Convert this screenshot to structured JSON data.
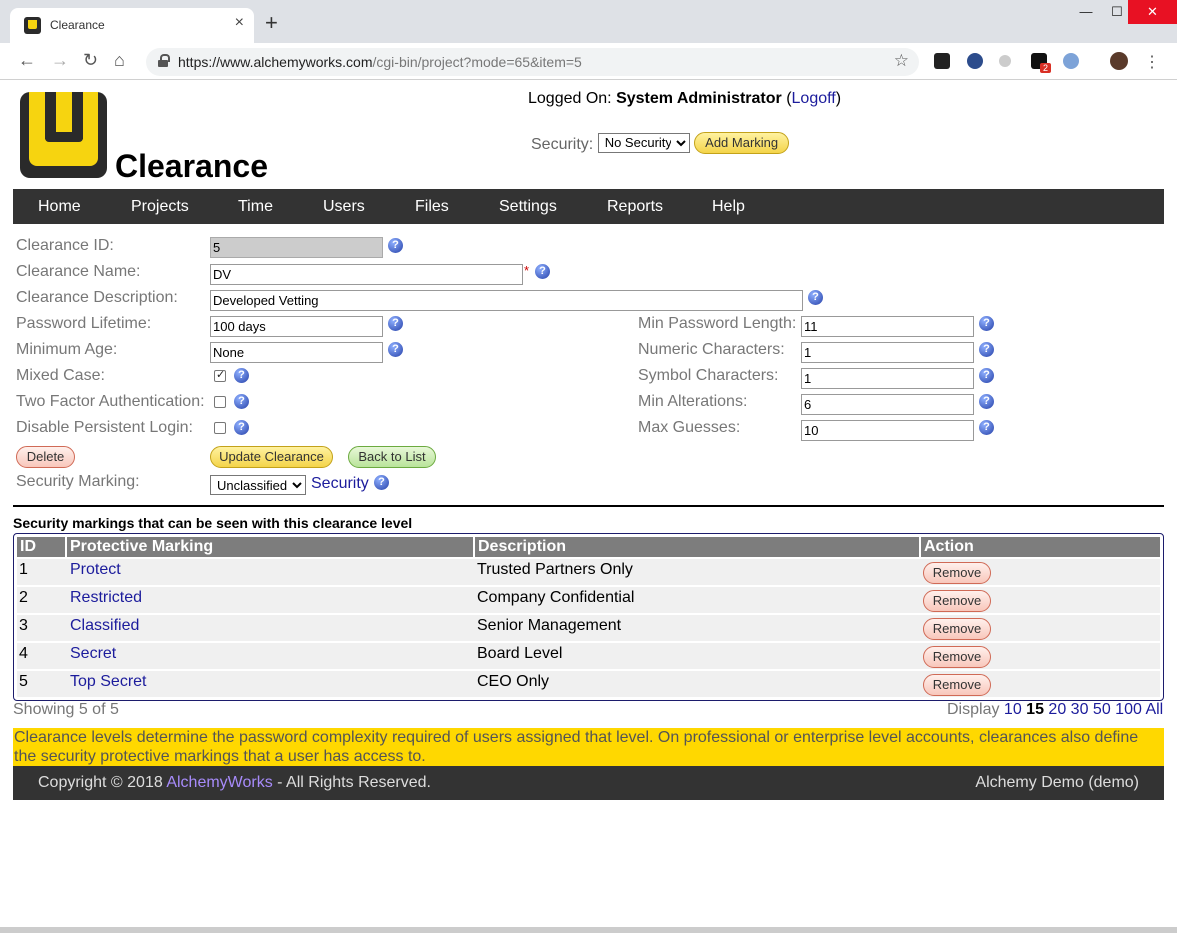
{
  "browser": {
    "tab_title": "Clearance",
    "tab_close": "×",
    "new_tab": "+",
    "url_host": "https://www.alchemyworks.com",
    "url_path": "/cgi-bin/project?mode=65&item=5",
    "ext_badge": "2",
    "window_min": "—",
    "window_max": "☐",
    "window_close": "✕"
  },
  "header": {
    "app_title": "Clearance",
    "logged_prefix": "Logged On:",
    "user_name": "System Administrator",
    "logoff": "Logoff",
    "security_label": "Security:",
    "security_value": "No Security",
    "add_marking": "Add Marking"
  },
  "nav": [
    "Home",
    "Projects",
    "Time",
    "Users",
    "Files",
    "Settings",
    "Reports",
    "Help"
  ],
  "form": {
    "clearance_id_label": "Clearance ID:",
    "clearance_id": "5",
    "clearance_name_label": "Clearance Name:",
    "clearance_name": "DV",
    "required_mark": "*",
    "description_label": "Clearance Description:",
    "description": "Developed Vetting",
    "password_lifetime_label": "Password Lifetime:",
    "password_lifetime": "100 days",
    "minimum_age_label": "Minimum Age:",
    "minimum_age": "None",
    "mixed_case_label": "Mixed Case:",
    "mixed_case": true,
    "two_factor_label": "Two Factor Authentication:",
    "two_factor": false,
    "disable_persistent_label": "Disable Persistent Login:",
    "disable_persistent": false,
    "min_password_length_label": "Min Password Length:",
    "min_password_length": "11",
    "numeric_chars_label": "Numeric Characters:",
    "numeric_chars": "1",
    "symbol_chars_label": "Symbol Characters:",
    "symbol_chars": "1",
    "min_alterations_label": "Min Alterations:",
    "min_alterations": "6",
    "max_guesses_label": "Max Guesses:",
    "max_guesses": "10",
    "delete": "Delete",
    "update": "Update Clearance",
    "back": "Back to List",
    "security_marking_label": "Security Marking:",
    "security_marking": "Unclassified",
    "security_link": "Security",
    "help": "?"
  },
  "markings": {
    "title": "Security markings that can be seen with this clearance level",
    "columns": [
      "ID",
      "Protective Marking",
      "Description",
      "Action"
    ],
    "rows": [
      {
        "id": "1",
        "marking": "Protect",
        "description": "Trusted Partners Only",
        "action": "Remove"
      },
      {
        "id": "2",
        "marking": "Restricted",
        "description": "Company Confidential",
        "action": "Remove"
      },
      {
        "id": "3",
        "marking": "Classified",
        "description": "Senior Management",
        "action": "Remove"
      },
      {
        "id": "4",
        "marking": "Secret",
        "description": "Board Level",
        "action": "Remove"
      },
      {
        "id": "5",
        "marking": "Top Secret",
        "description": "CEO Only",
        "action": "Remove"
      }
    ],
    "showing": "Showing 5 of 5",
    "display_label": "Display",
    "display_options": [
      "10",
      "15",
      "20",
      "30",
      "50",
      "100",
      "All"
    ],
    "display_selected": "15"
  },
  "notice": "Clearance levels determine the password complexity required of users assigned that level. On professional or enterprise level accounts, clearances also define the security protective markings that a user has access to.",
  "footer": {
    "copyright": "Copyright © 2018",
    "company": "AlchemyWorks",
    "rights": "- All Rights Reserved.",
    "account": "Alchemy Demo (demo)"
  }
}
